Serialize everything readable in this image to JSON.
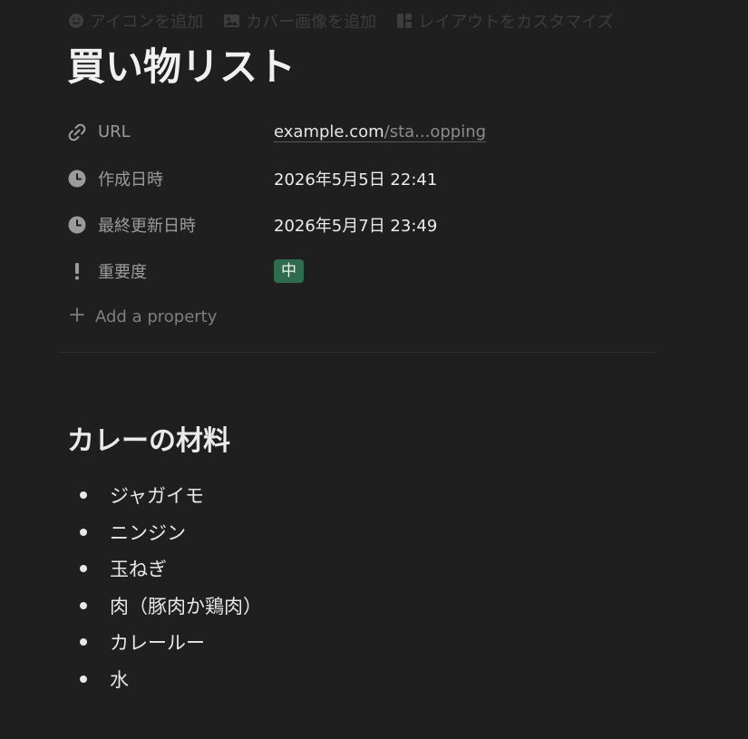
{
  "top_actions": [
    {
      "label": "アイコンを追加",
      "icon": "smiley-icon"
    },
    {
      "label": "カバー画像を追加",
      "icon": "image-icon"
    },
    {
      "label": "レイアウトをカスタマイズ",
      "icon": "layout-icon"
    }
  ],
  "page": {
    "title": "買い物リスト"
  },
  "properties": {
    "url": {
      "label": "URL",
      "host": "example.com",
      "path": "/sta...opping",
      "icon": "link-icon"
    },
    "created": {
      "label": "作成日時",
      "value": "2026年5月5日 22:41",
      "icon": "clock-icon"
    },
    "updated": {
      "label": "最終更新日時",
      "value": "2026年5月7日 23:49",
      "icon": "clock-icon"
    },
    "priority": {
      "label": "重要度",
      "value": "中",
      "icon": "exclamation-icon",
      "tag_color": "#2f6b4f"
    },
    "add_property": {
      "label": "Add a property",
      "icon": "plus-icon"
    }
  },
  "content": {
    "heading": "カレーの材料",
    "items": [
      "ジャガイモ",
      "ニンジン",
      "玉ねぎ",
      "肉（豚肉か鶏肉）",
      "カレールー",
      "水"
    ]
  },
  "colors": {
    "background": "#1f1f1f",
    "text": "#e8e8e8",
    "muted": "#9b9b9b",
    "tag_green": "#2f6b4f"
  }
}
